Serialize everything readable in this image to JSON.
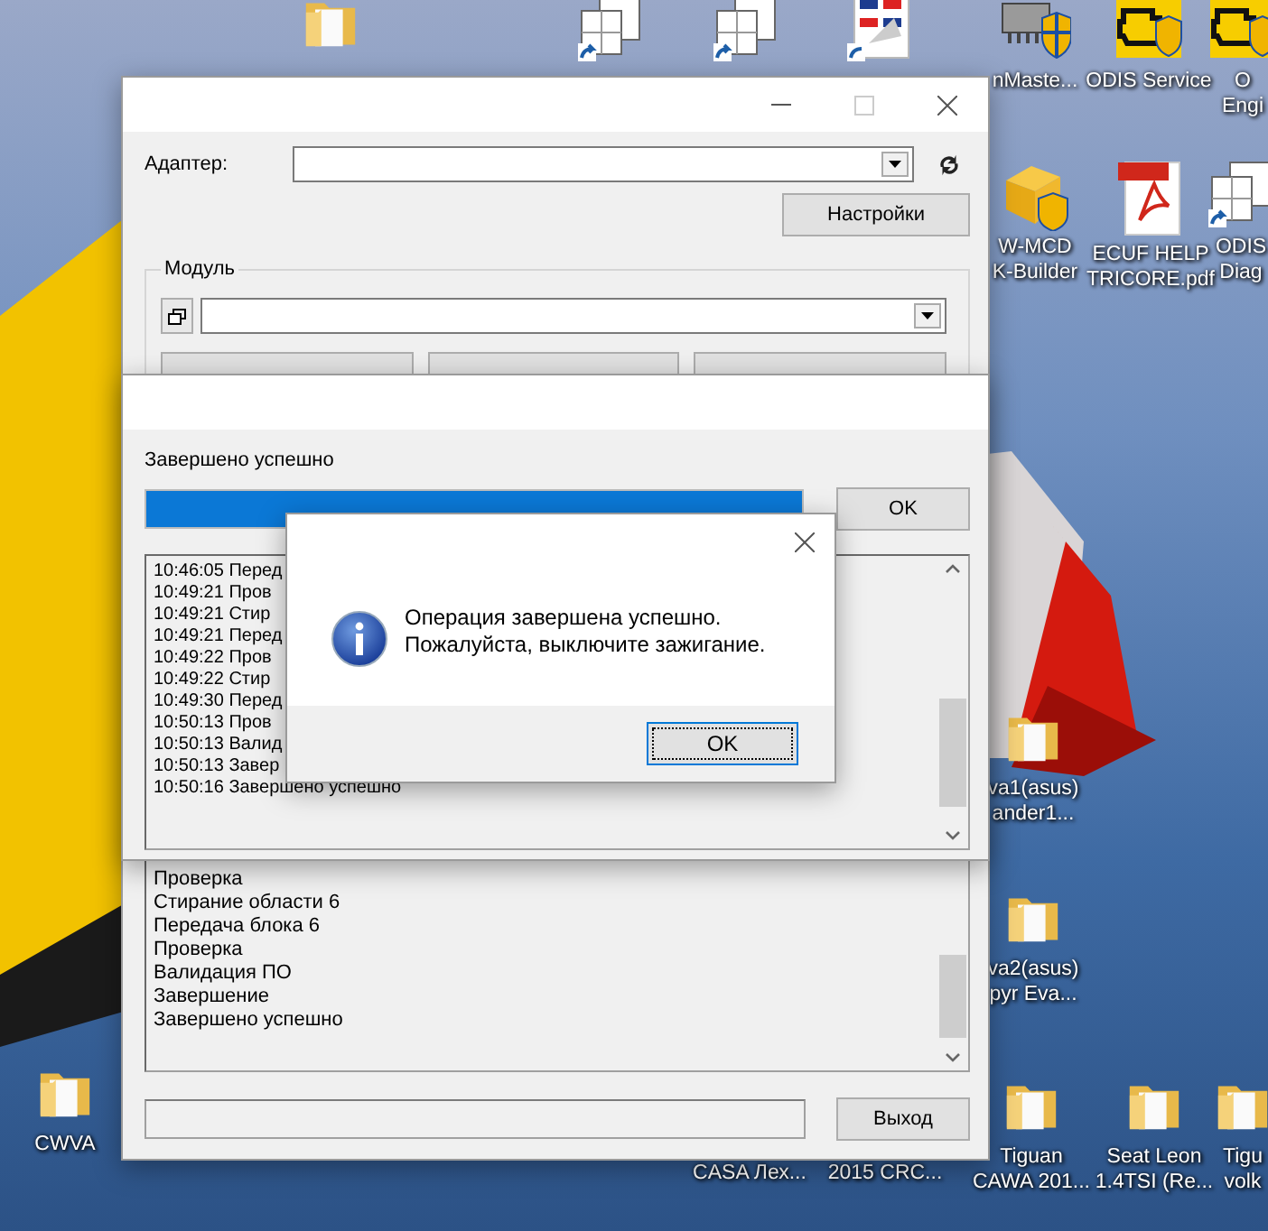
{
  "desktop": {
    "icons": [
      {
        "kind": "folder"
      },
      {
        "kind": "app"
      },
      {
        "kind": "app"
      },
      {
        "kind": "chart"
      },
      {
        "kind": "chip",
        "label_lines": [
          "nMaste..."
        ]
      },
      {
        "kind": "engine",
        "label_lines": [
          "ODIS Service"
        ]
      },
      {
        "kind": "engine",
        "label_lines": [
          "O",
          "Engi"
        ]
      },
      {
        "kind": "package",
        "label_lines": [
          "W-MCD",
          "K-Builder"
        ]
      },
      {
        "kind": "pdf",
        "label_lines": [
          "ECUF HELP",
          "TRICORE.pdf"
        ]
      },
      {
        "kind": "app",
        "label_lines": [
          "ODIS",
          "Diag"
        ]
      },
      {
        "kind": "folder",
        "label_lines": [
          "va1(asus)",
          "ander1..."
        ]
      },
      {
        "kind": "folder",
        "label_lines": [
          "va2(asus)",
          "pyr Eva..."
        ]
      },
      {
        "kind": "folder",
        "label_lines": [
          "CWVA"
        ]
      },
      {
        "kind": "none",
        "label_lines": [
          "CASA Лех..."
        ]
      },
      {
        "kind": "none",
        "label_lines": [
          "2015 CRC..."
        ]
      },
      {
        "kind": "folder",
        "label_lines": [
          "Tiguan",
          "CAWA 201..."
        ]
      },
      {
        "kind": "folder",
        "label_lines": [
          "Seat Leon",
          "1.4TSI (Re..."
        ]
      },
      {
        "kind": "folder",
        "label_lines": [
          "Tigu",
          "volk"
        ]
      }
    ]
  },
  "main_window": {
    "adapter_label": "Адаптер:",
    "settings_button": "Настройки",
    "module_group_label": "Модуль",
    "log_lines": [
      "Проверка",
      "Стирание области 6",
      "Передача блока 6",
      "Проверка",
      "Валидация ПО",
      "Завершение",
      "Завершено успешно"
    ],
    "exit_button": "Выход"
  },
  "progress_dialog": {
    "status": "Завершено успешно",
    "progress": {
      "level": 1
    },
    "ok_button": "OK",
    "log_lines": [
      "10:46:05 Перед",
      "10:49:21 Пров",
      "10:49:21 Стир",
      "10:49:21 Перед",
      "10:49:22 Пров",
      "10:49:22 Стир",
      "10:49:30 Перед",
      "10:50:13 Пров",
      "10:50:13 Валид",
      "10:50:13 Завер",
      "10:50:16 Завершено успешно"
    ]
  },
  "message_box": {
    "message_lines": [
      "Операция завершена успешно.",
      "Пожалуйста, выключите зажигание."
    ],
    "ok_button": "OK"
  }
}
